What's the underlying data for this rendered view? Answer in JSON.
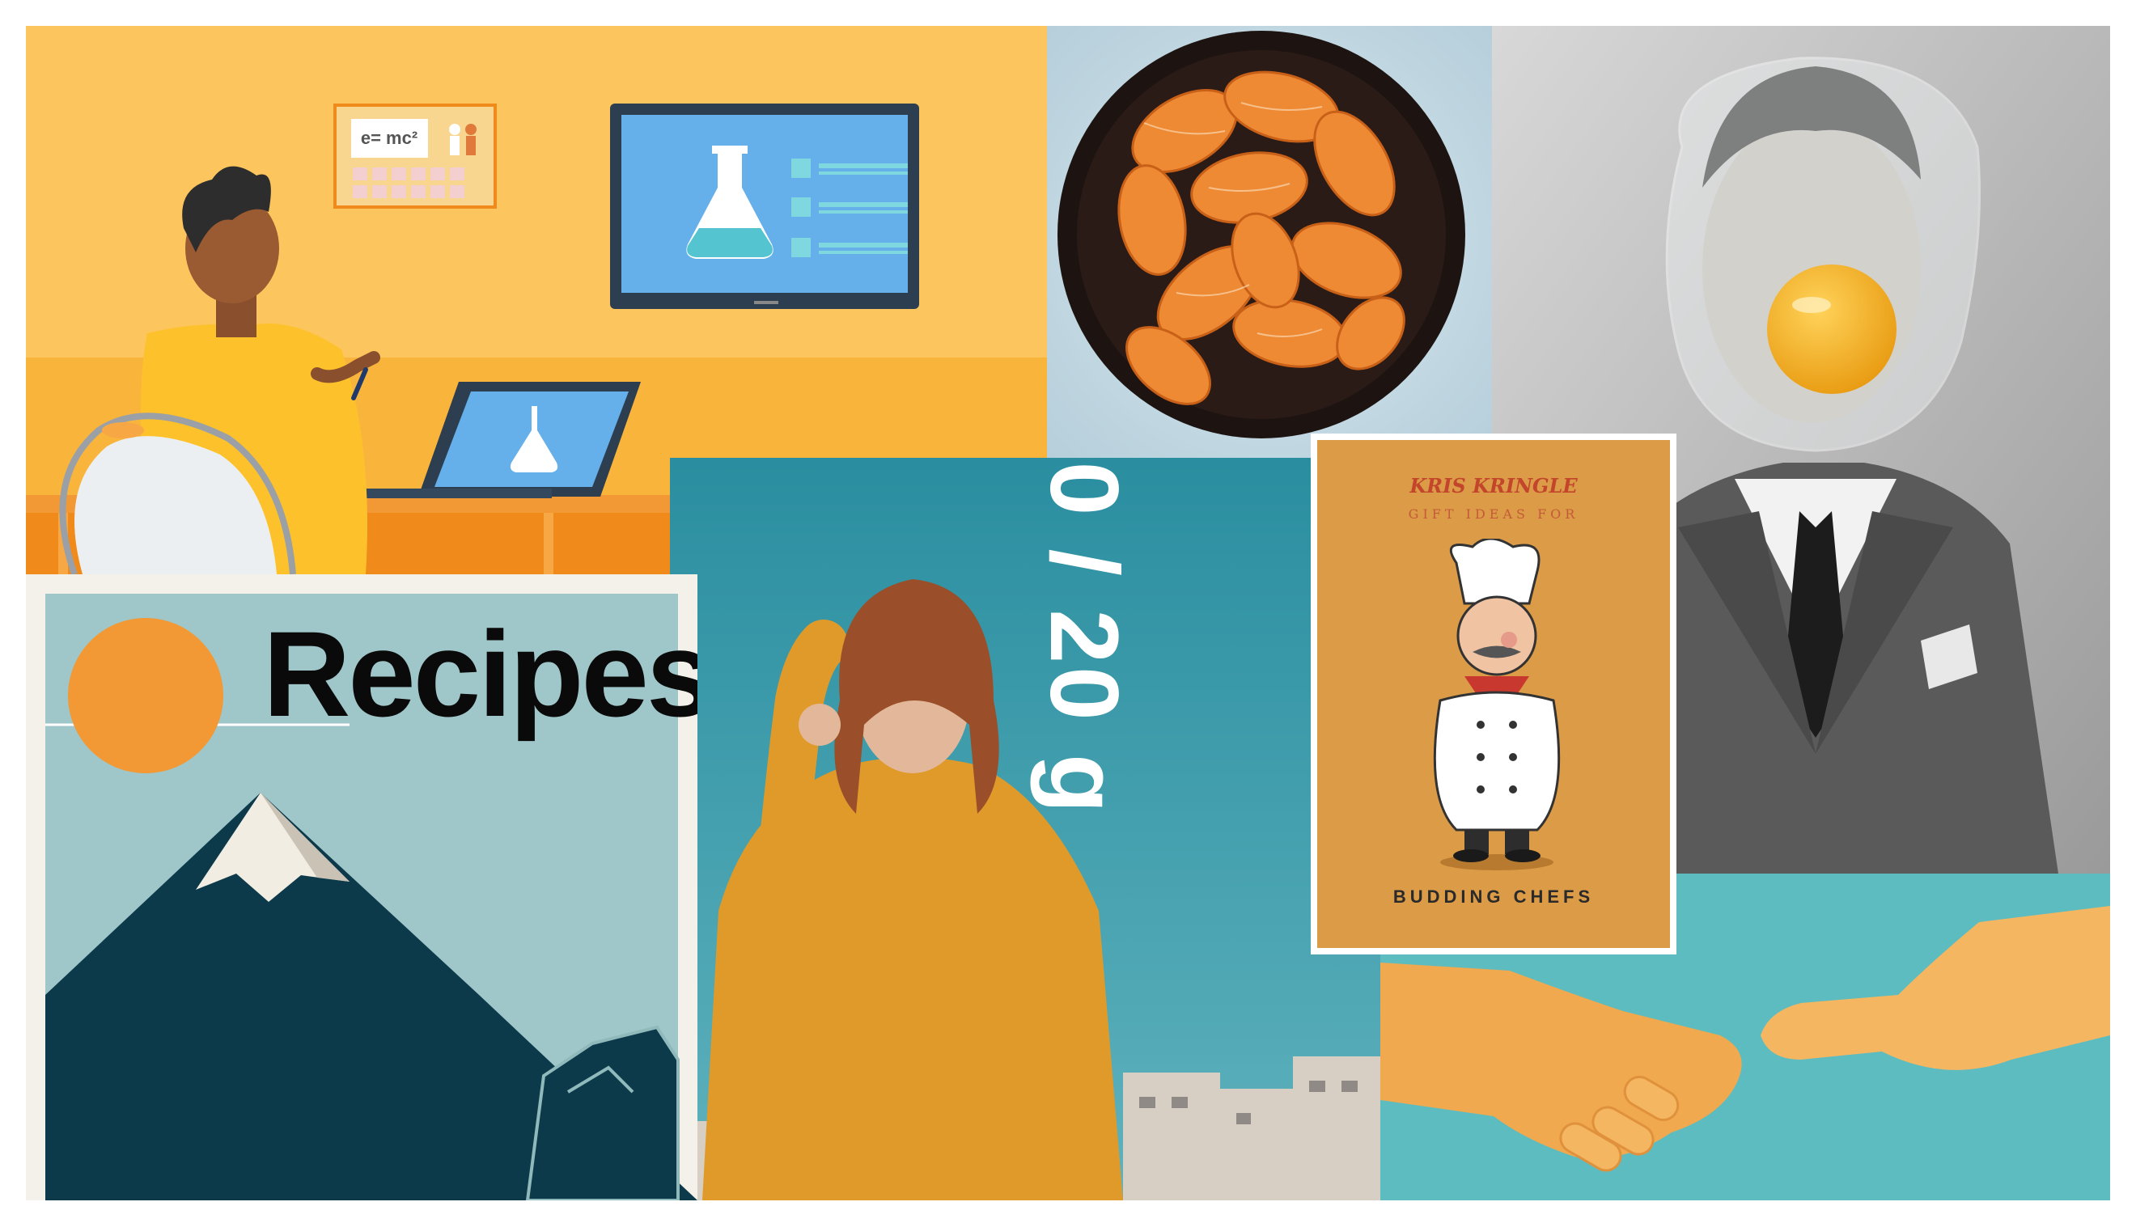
{
  "collage": {
    "heading": "Recipes",
    "measurement": "0 / 20 g",
    "gift_card": {
      "brand": "KRIS KRINGLE",
      "subtitle": "GIFT IDEAS FOR",
      "title": "BUDDING CHEFS"
    },
    "poster": {
      "formula": "e= mc²"
    }
  },
  "colors": {
    "workspace_bg": "#fbbe55",
    "accent_orange": "#f29935",
    "teal_sky": "#2e93a5",
    "card_bg": "#dc9b46",
    "handshake_bg": "#5cbcc0",
    "mountain_sky": "#9fc6c8",
    "mountain_dark": "#0c3a4a"
  }
}
